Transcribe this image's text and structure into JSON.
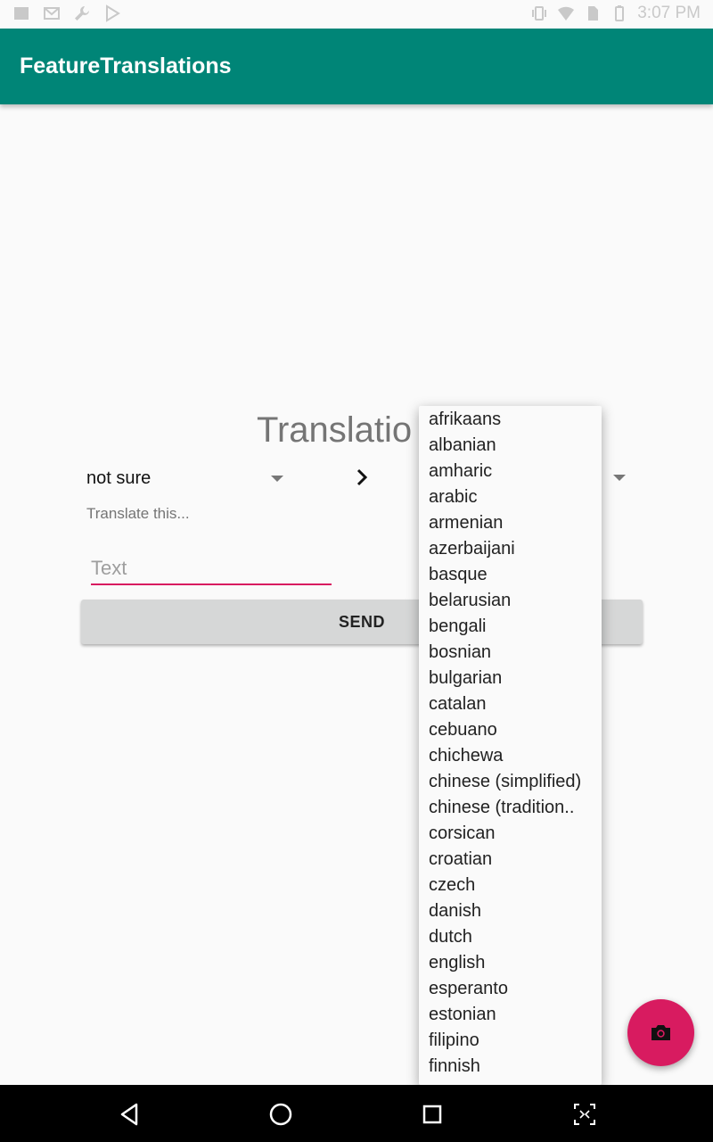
{
  "status_bar": {
    "time": "3:07 PM",
    "left_icons": [
      "notification-square-icon",
      "gmail-icon",
      "wrench-icon",
      "play-store-icon"
    ],
    "right_icons": [
      "vibrate-icon",
      "wifi-icon",
      "sim-icon",
      "battery-icon"
    ]
  },
  "app_bar": {
    "title": "FeatureTranslations"
  },
  "main": {
    "heading": "Translatio",
    "source_language": "not sure",
    "translate_hint": "Translate this...",
    "text_input_placeholder": "Text",
    "send_label": "SEND"
  },
  "dropdown": {
    "options": [
      "afrikaans",
      "albanian",
      "amharic",
      "arabic",
      "armenian",
      "azerbaijani",
      "basque",
      "belarusian",
      "bengali",
      "bosnian",
      "bulgarian",
      "catalan",
      "cebuano",
      "chichewa",
      "chinese (simplified)",
      "chinese (tradition..",
      "corsican",
      "croatian",
      "czech",
      "danish",
      "dutch",
      "english",
      "esperanto",
      "estonian",
      "filipino",
      "finnish"
    ]
  },
  "fab": {
    "icon": "camera-icon"
  },
  "nav_bar": {
    "icons": [
      "back-icon",
      "home-icon",
      "recents-icon",
      "screenshot-icon"
    ]
  },
  "colors": {
    "primary": "#008577",
    "accent": "#D81B60"
  }
}
